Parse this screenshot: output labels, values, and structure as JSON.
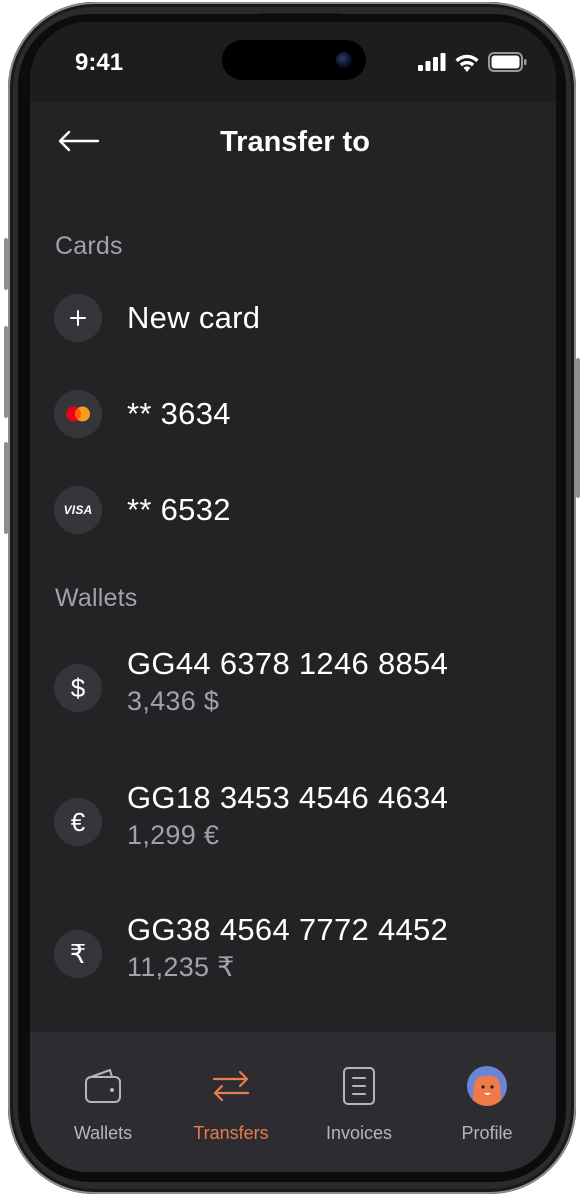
{
  "status_bar": {
    "time": "9:41",
    "icons": [
      "signal-icon",
      "wifi-icon",
      "battery-icon"
    ]
  },
  "header": {
    "title": "Transfer to",
    "back_icon": "arrow-left-icon"
  },
  "cards": {
    "section_label": "Cards",
    "items": [
      {
        "label": "New card",
        "icon": "plus-icon"
      },
      {
        "label": "** 3634",
        "icon": "mastercard-icon"
      },
      {
        "label": "** 6532",
        "icon": "visa-icon",
        "icon_text": "VISA"
      }
    ]
  },
  "wallets": {
    "section_label": "Wallets",
    "items": [
      {
        "number": "GG44 6378 1246 8854",
        "balance": "3,436 $",
        "symbol": "$"
      },
      {
        "number": "GG18 3453 4546 4634",
        "balance": "1,299 €",
        "symbol": "€"
      },
      {
        "number": "GG38 4564 7772 4452",
        "balance": "11,235 ₹",
        "symbol": "₹"
      }
    ]
  },
  "tab_bar": {
    "tabs": [
      {
        "label": "Wallets",
        "icon": "wallet-icon",
        "active": false
      },
      {
        "label": "Transfers",
        "icon": "transfer-arrows-icon",
        "active": true
      },
      {
        "label": "Invoices",
        "icon": "invoice-icon",
        "active": false
      },
      {
        "label": "Profile",
        "icon": "avatar",
        "active": false
      }
    ]
  },
  "colors": {
    "background": "#232326",
    "accent": "#e87b4f",
    "muted_text": "#9fa2ab",
    "icon_circle": "#36363a",
    "tab_bar": "#2d2d31"
  }
}
